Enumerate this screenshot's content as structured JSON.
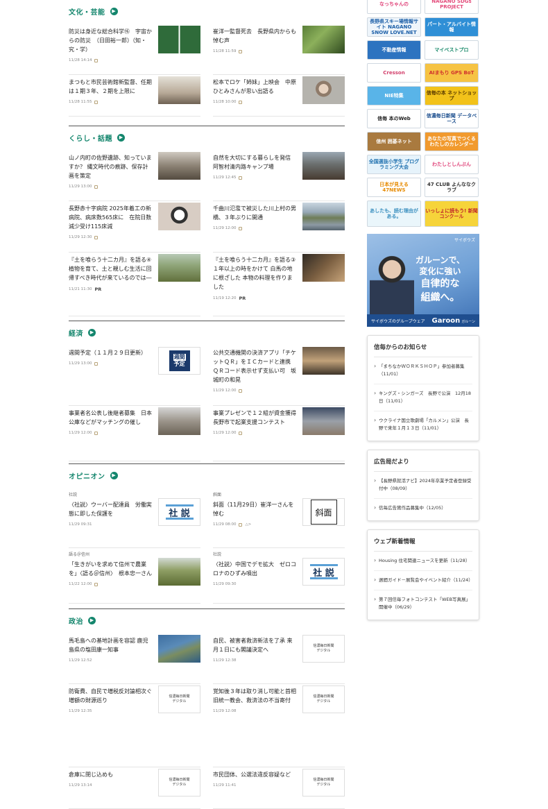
{
  "sections": [
    {
      "title": "文化・芸能",
      "articles": [
        {
          "title": "防災は身近な総合科学⑯　宇宙からの防災　（日田裕一郎）（知・究・学）",
          "time": "11/28 14:14",
          "lock": true,
          "thumb": "learning-illustration"
        },
        {
          "title": "崔洋一監督死去　長野県内からも悼む声",
          "time": "11/28 11:59",
          "lock": true,
          "thumb": "photo"
        },
        {
          "title": "まつもと市民芸術館新監督、任期は１期３年、２期を上限に",
          "time": "11/28 11:55",
          "lock": true,
          "thumb": "photo"
        },
        {
          "title": "松本でロケ「姉妹」上映会　中原ひとみさんが思い出語る",
          "time": "11/28 10:00",
          "lock": true,
          "thumb": "photo"
        }
      ]
    },
    {
      "title": "くらし・話題",
      "articles": [
        {
          "title": "山ノ内町の佐野遺跡、知っていますか？ 縄文時代の痕跡、保存計画を策定",
          "time": "11/29 13:00",
          "lock": true,
          "thumb": "photo"
        },
        {
          "title": "自然を大切にする暮らしを発信　阿智村清内路キャンプ場",
          "time": "11/29 12:45",
          "lock": true,
          "thumb": "photo"
        },
        {
          "title": "長野赤十字病院 2025年着工の新病院、病床数565床に　在院日数減少受け115床減",
          "time": "11/29 12:30",
          "lock": true,
          "thumb": "photo"
        },
        {
          "title": "千曲川氾濫で被災した川上村の男橋、３年ぶりに開通",
          "time": "11/29 12:00",
          "lock": true,
          "thumb": "photo"
        },
        {
          "title": "『土を喰らう十二カ月』を語る④　植物を育て、土と親しむ生活に回帰すべき時代が来ているのでは―",
          "time": "11/21 11:30",
          "pr": "PR",
          "thumb": "photo"
        },
        {
          "title": "『土を喰らう十二カ月』を語る③　１年以上の時をかけて 白馬の地に根ざした 本物の料理を作りました",
          "time": "11/19 12:20",
          "pr": "PR",
          "thumb": "photo"
        }
      ]
    },
    {
      "title": "経済",
      "articles": [
        {
          "title": "週間予定（１１月２９日更新）",
          "time": "11/29 13:00",
          "lock": true,
          "thumb": "shukan-logo"
        },
        {
          "title": "公共交通機関の決済アプリ「チケットＱＲ」をＩＣカードと連携　ＱＲコード表示せず支払い可　坂城町の和晃",
          "time": "11/29 12:00",
          "lock": true,
          "thumb": "photo"
        },
        {
          "title": "事業者名公表し後継者募集　日本公庫などがマッチングの催し",
          "time": "11/29 12:00",
          "lock": true,
          "thumb": "photo"
        },
        {
          "title": "事業プレゼンで１２組が資金獲得　長野市で起業支援コンテスト",
          "time": "11/29 12:00",
          "lock": true,
          "thumb": "photo"
        }
      ]
    },
    {
      "title": "オピニオン",
      "articles": [
        {
          "category": "社説",
          "title": "〈社説〉ウーバー配達員　労働実態に即した保護を",
          "time": "11/29 09:31",
          "thumb": "shasetsu-logo"
        },
        {
          "category": "斜面",
          "title": "斜面（11月29日）崔洋一さんを悼む",
          "time": "11/29 08:00",
          "lock": true,
          "extra": "△>",
          "thumb": "shamen-logo"
        },
        {
          "category": "語る＠信州",
          "title": "「生きがいを求めて信州で農業を」〈語る＠信州〉　根本忠一さん",
          "time": "11/22 12:00",
          "lock": true,
          "thumb": "photo"
        },
        {
          "category": "社説",
          "title": "〈社説〉中国でデモ拡大　ゼロコロナのひずみ噴出",
          "time": "11/29 09:30",
          "thumb": "shasetsu-logo"
        }
      ]
    },
    {
      "title": "政治",
      "articles": [
        {
          "title": "馬毛島への基地計画を容認 鹿児島県の塩田康一知事",
          "time": "11/29 12:52",
          "thumb": "photo"
        },
        {
          "title": "自民、被害者救済新法を了承 来月１日にも閣議決定へ",
          "time": "11/29 12:38",
          "thumb": "digital-logo"
        },
        {
          "title": "防衛費、自民で増税反対論相次ぐ 増額の財源巡り",
          "time": "11/29 12:35",
          "thumb": "digital-logo"
        },
        {
          "title": "覚知後３年は取り消し可能と首相 旧統一教会、救済法の不当寄付",
          "time": "11/29 12:08",
          "thumb": "digital-logo"
        },
        {
          "title": "倉庫に閉じ込めも",
          "time": "11/29 13:14",
          "thumb": "digital-logo"
        },
        {
          "title": "市民団体、公選法違反容疑など",
          "time": "11/29 11:41",
          "thumb": "digital-logo"
        }
      ]
    }
  ],
  "logos": {
    "shasetsu": "社 説",
    "shamen": "斜面",
    "shukan": [
      "週間",
      "予定"
    ],
    "digital": [
      "信濃毎日新聞",
      "デジタル"
    ]
  },
  "banners": [
    {
      "text": "なっちゃんの",
      "bg": "#fff",
      "fg": "#e0447a"
    },
    {
      "text": "NAGANO SDGs PROJECT",
      "bg": "#fff",
      "fg": "#e44c7c"
    },
    {
      "text": "長野県スキー場情報サイト NAGANO SNOW LOVE.NET",
      "bg": "#eef5fb",
      "fg": "#1c5fa8"
    },
    {
      "text": "パート・アルバイト情報",
      "bg": "#2f8fd6",
      "fg": "#fff"
    },
    {
      "text": "不動産情報",
      "bg": "#2c73c0",
      "fg": "#fff"
    },
    {
      "text": "マイベストプロ",
      "bg": "#fff",
      "fg": "#1a8a6b"
    },
    {
      "text": "Cresson",
      "bg": "#fff",
      "fg": "#d23f6b"
    },
    {
      "text": "AIまもり GPS BoT",
      "bg": "#f6c343",
      "fg": "#d0312d"
    },
    {
      "text": "NIE特集",
      "bg": "#59b4e8",
      "fg": "#fff"
    },
    {
      "text": "信毎の本 ネットショップ",
      "bg": "#f2c21a",
      "fg": "#5a3b00"
    },
    {
      "text": "信毎 本のWeb",
      "bg": "#fff",
      "fg": "#222"
    },
    {
      "text": "信濃毎日新聞 データベース",
      "bg": "#fff",
      "fg": "#1c4f8f"
    },
    {
      "text": "信州 囲碁ネット",
      "bg": "#a97a3f",
      "fg": "#fff"
    },
    {
      "text": "あなたの写真でつくる わたしのカレンダー",
      "bg": "#f19a2e",
      "fg": "#fff"
    },
    {
      "text": "全国選抜小学生 プログラミング大会",
      "bg": "#e6f3fb",
      "fg": "#1d6fae"
    },
    {
      "text": "わたしとしんぶん",
      "bg": "#fff",
      "fg": "#e0447a"
    },
    {
      "text": "日本が見える 47NEWS",
      "bg": "#fff",
      "fg": "#e68a00"
    },
    {
      "text": "47 CLUB よんななクラブ",
      "bg": "#fff",
      "fg": "#333"
    },
    {
      "text": "あしたも、読む理由がある。",
      "bg": "#eaf6fb",
      "fg": "#3a8fbf"
    },
    {
      "text": "いっしょに読もう! 新聞コンクール",
      "bg": "#f6d43a",
      "fg": "#c22a2a"
    }
  ],
  "ad": {
    "brand": "サイボウズ",
    "line1": "ガルーンで、",
    "line2": "変化に強い",
    "line3": "自律的な",
    "line4": "組織へ。",
    "footer_left": "サイボウズのグループウェア",
    "footer_right": "Garoon",
    "footer_sub": "ガルーン"
  },
  "boxes": [
    {
      "title": "信毎からのお知らせ",
      "items": [
        "「まちなかＷＯＲＫＳＨＯＰ」参加者募集（11/01）",
        "キングズ・シンガーズ　長野で公演　12月18日（11/01）",
        "ウクライナ国立歌劇場「カルメン」公演　長野で来年１月１３日（11/01）"
      ]
    },
    {
      "title": "広告局だより",
      "items": [
        "【長野県就活ナビ】2024年卒業予定者登録受付中（08/09）",
        "信毎広告賞作品募集中（12/05）"
      ]
    },
    {
      "title": "ウェブ新着情報",
      "items": [
        "Housing 住宅関連ニュースを更新（11/28）",
        "週間ガイド－展覧会やイベント紹介（11/24）",
        "第７回信毎フォトコンテスト「WEB写真展」開催中（06/29）"
      ]
    }
  ]
}
